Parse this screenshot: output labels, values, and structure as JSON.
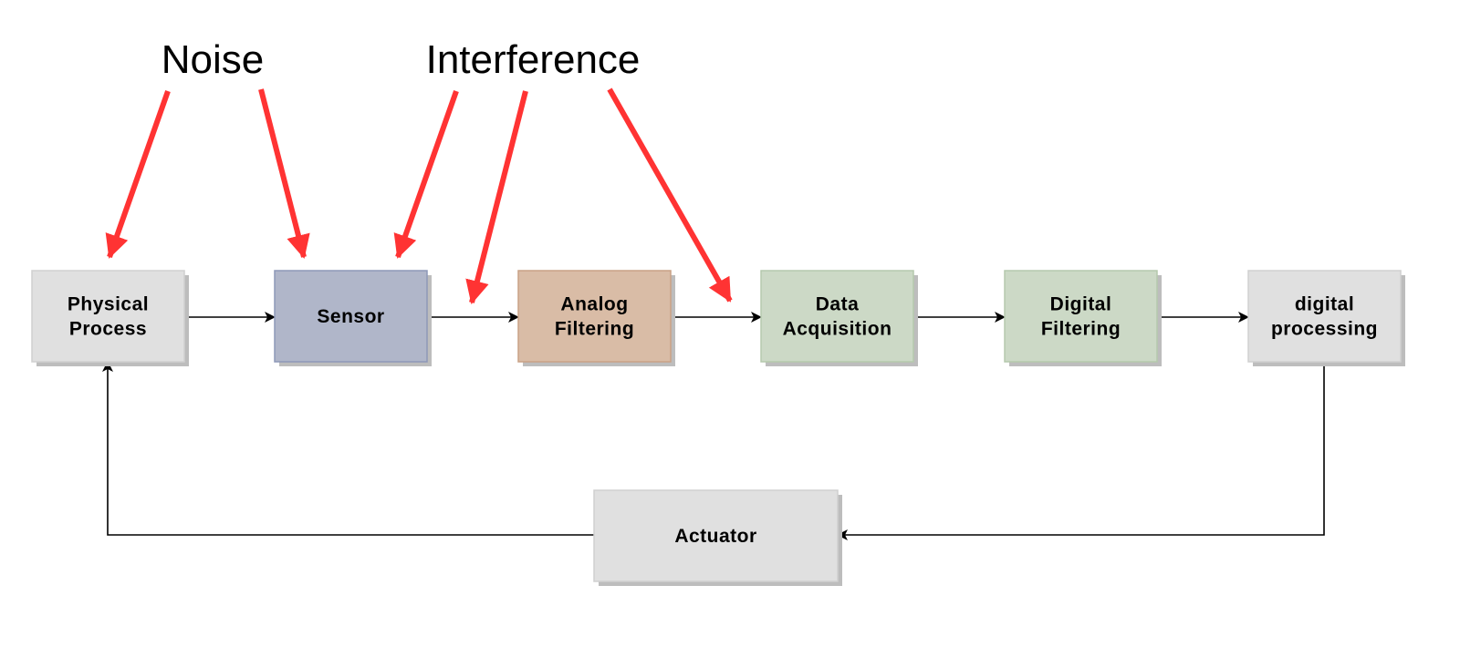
{
  "annotations": {
    "noise_label": "Noise",
    "interference_label": "Interference",
    "arrow_color": "#ff3333"
  },
  "blocks": [
    {
      "id": "physical-process",
      "lines": [
        "Physical",
        "Process"
      ],
      "fill": "#e0e0e0",
      "stroke": "#d0d0d0"
    },
    {
      "id": "sensor",
      "lines": [
        "Sensor"
      ],
      "fill": "#b0b6c9",
      "stroke": "#8e98b8"
    },
    {
      "id": "analog-filtering",
      "lines": [
        "Analog",
        "Filtering"
      ],
      "fill": "#d9bca6",
      "stroke": "#c9a286"
    },
    {
      "id": "data-acquisition",
      "lines": [
        "Data",
        "Acquisition"
      ],
      "fill": "#ccd9c6",
      "stroke": "#b5c9ad"
    },
    {
      "id": "digital-filtering",
      "lines": [
        "Digital",
        "Filtering"
      ],
      "fill": "#ccd9c6",
      "stroke": "#b5c9ad"
    },
    {
      "id": "digital-processing",
      "lines": [
        "digital",
        "processing"
      ],
      "fill": "#e0e0e0",
      "stroke": "#d0d0d0"
    }
  ],
  "actuator": {
    "id": "actuator",
    "lines": [
      "Actuator"
    ],
    "fill": "#e0e0e0",
    "stroke": "#d0d0d0"
  },
  "flow": [
    "physical-process",
    "sensor",
    "analog-filtering",
    "data-acquisition",
    "digital-filtering",
    "digital-processing",
    "actuator",
    "physical-process"
  ],
  "noise_targets": [
    "physical-process",
    "sensor"
  ],
  "interference_targets": [
    "sensor",
    "sensor-to-analog-filtering-link",
    "data-acquisition"
  ]
}
